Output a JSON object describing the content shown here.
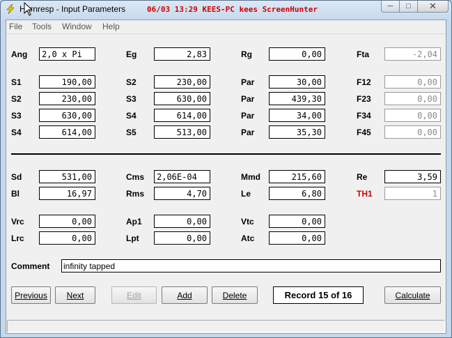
{
  "window": {
    "title": "Hornresp - Input Parameters",
    "overlay": "06/03 13:29 KEES-PC kees ScreenHunter"
  },
  "menu": [
    "File",
    "Tools",
    "Window",
    "Help"
  ],
  "top": {
    "ang": {
      "label": "Ang",
      "value": "2,0 x Pi"
    },
    "eg": {
      "label": "Eg",
      "value": "2,83"
    },
    "rg": {
      "label": "Rg",
      "value": "0,00"
    },
    "fta": {
      "label": "Fta",
      "value": "-2,04"
    }
  },
  "rows": [
    {
      "c1l": "S1",
      "c1v": "190,00",
      "c2l": "S2",
      "c2v": "230,00",
      "c3l": "Par",
      "c3v": "30,00",
      "c4l": "F12",
      "c4v": "0,00"
    },
    {
      "c1l": "S2",
      "c1v": "230,00",
      "c2l": "S3",
      "c2v": "630,00",
      "c3l": "Par",
      "c3v": "439,30",
      "c4l": "F23",
      "c4v": "0,00"
    },
    {
      "c1l": "S3",
      "c1v": "630,00",
      "c2l": "S4",
      "c2v": "614,00",
      "c3l": "Par",
      "c3v": "34,00",
      "c4l": "F34",
      "c4v": "0,00"
    },
    {
      "c1l": "S4",
      "c1v": "614,00",
      "c2l": "S5",
      "c2v": "513,00",
      "c3l": "Par",
      "c3v": "35,30",
      "c4l": "F45",
      "c4v": "0,00"
    }
  ],
  "driver": {
    "sd": {
      "label": "Sd",
      "value": "531,00"
    },
    "cms": {
      "label": "Cms",
      "value": "2,06E-04"
    },
    "mmd": {
      "label": "Mmd",
      "value": "215,60"
    },
    "re": {
      "label": "Re",
      "value": "3,59"
    },
    "bl": {
      "label": "Bl",
      "value": "16,97"
    },
    "rms": {
      "label": "Rms",
      "value": "4,70"
    },
    "le": {
      "label": "Le",
      "value": "6,80"
    },
    "th1": {
      "label": "TH1",
      "value": "1"
    }
  },
  "chambers": {
    "vrc": {
      "label": "Vrc",
      "value": "0,00"
    },
    "ap1": {
      "label": "Ap1",
      "value": "0,00"
    },
    "vtc": {
      "label": "Vtc",
      "value": "0,00"
    },
    "lrc": {
      "label": "Lrc",
      "value": "0,00"
    },
    "lpt": {
      "label": "Lpt",
      "value": "0,00"
    },
    "atc": {
      "label": "Atc",
      "value": "0,00"
    }
  },
  "comment": {
    "label": "Comment",
    "value": "infinity tapped"
  },
  "buttons": {
    "previous": "Previous",
    "next": "Next",
    "edit": "Edit",
    "add": "Add",
    "delete": "Delete",
    "calculate": "Calculate"
  },
  "record": "Record 15 of 16",
  "colors": {
    "accent_label": "#cc0000",
    "overlay": "#d00000"
  }
}
